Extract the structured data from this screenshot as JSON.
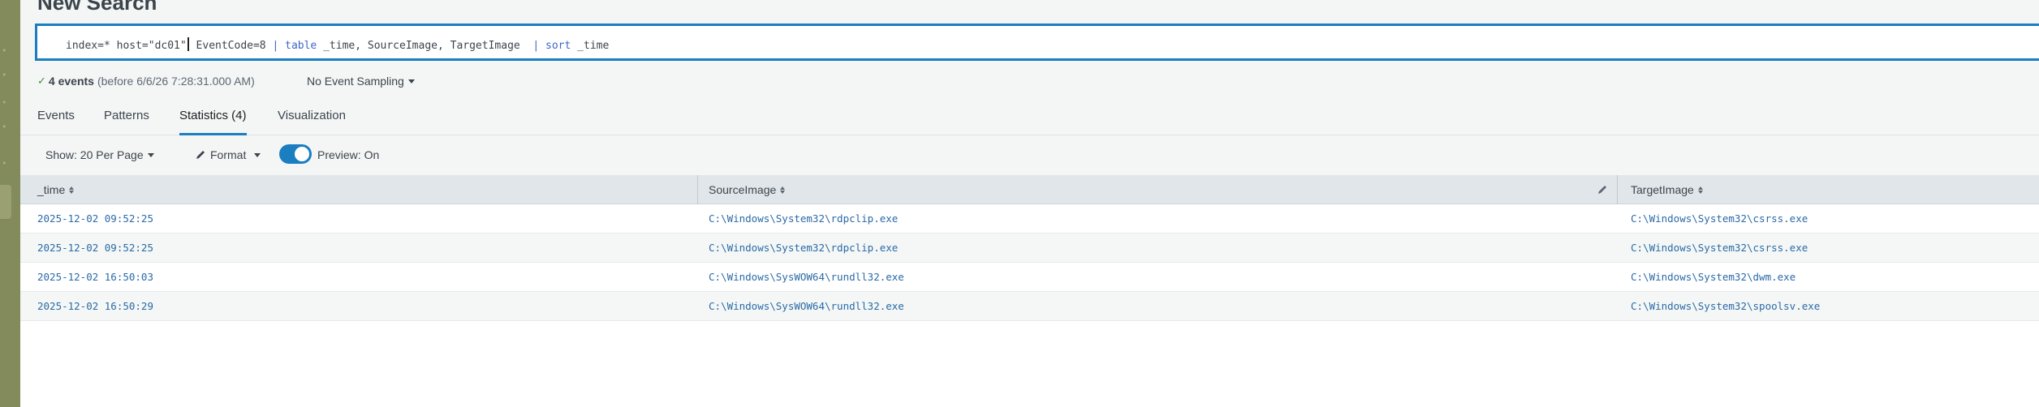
{
  "page": {
    "title": "New Search"
  },
  "search": {
    "query_parts": {
      "p1": "index=* host=\"dc01\"",
      "p2": " EventCode=8 ",
      "pipe1": "|",
      "kw1": " table",
      "p3": " _time, SourceImage, TargetImage  ",
      "pipe2": "|",
      "kw2": " sort",
      "p4": " _time"
    }
  },
  "status": {
    "events_count": "4 events",
    "events_before": "(before 6/6/26 7:28:31.000 AM)",
    "sampling": "No Event Sampling"
  },
  "tabs": [
    {
      "label": "Events",
      "active": false
    },
    {
      "label": "Patterns",
      "active": false
    },
    {
      "label": "Statistics (4)",
      "active": true
    },
    {
      "label": "Visualization",
      "active": false
    }
  ],
  "toolbar": {
    "show_per_page": "Show: 20 Per Page",
    "format": "Format",
    "preview": "Preview: On",
    "preview_enabled": true
  },
  "table": {
    "columns": [
      "_time",
      "SourceImage",
      "TargetImage"
    ],
    "rows": [
      [
        "2025-12-02 09:52:25",
        "C:\\Windows\\System32\\rdpclip.exe",
        "C:\\Windows\\System32\\csrss.exe"
      ],
      [
        "2025-12-02 09:52:25",
        "C:\\Windows\\System32\\rdpclip.exe",
        "C:\\Windows\\System32\\csrss.exe"
      ],
      [
        "2025-12-02 16:50:03",
        "C:\\Windows\\SysWOW64\\rundll32.exe",
        "C:\\Windows\\System32\\dwm.exe"
      ],
      [
        "2025-12-02 16:50:29",
        "C:\\Windows\\SysWOW64\\rundll32.exe",
        "C:\\Windows\\System32\\spoolsv.exe"
      ]
    ]
  },
  "colors": {
    "accent": "#1a7ec0",
    "link": "#2b6aa8",
    "left_rail": "#838a5c",
    "success": "#3d8f45"
  }
}
